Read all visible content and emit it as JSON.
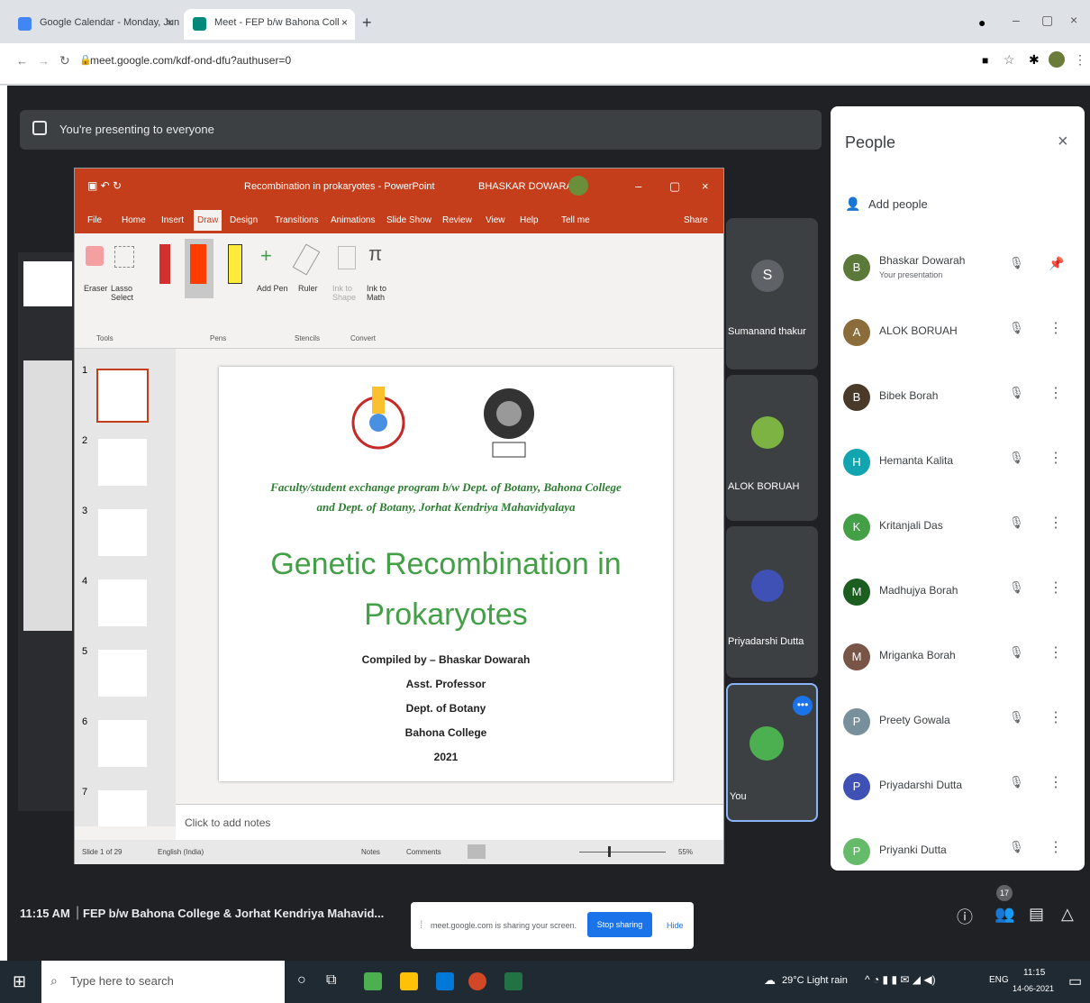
{
  "browser": {
    "tabs": [
      {
        "title": "Google Calendar - Monday, Jun",
        "close": "×"
      },
      {
        "title": "Meet - FEP b/w Bahona Coll",
        "close": "×"
      }
    ],
    "new_tab": "+",
    "url": "meet.google.com/kdf-ond-dfu?authuser=0"
  },
  "banner": {
    "text": "You're presenting to everyone"
  },
  "ppt": {
    "title": "Recombination in prokaryotes - PowerPoint",
    "user": "BHASKAR DOWARAH",
    "tabs": [
      "File",
      "Home",
      "Insert",
      "Draw",
      "Design",
      "Transitions",
      "Animations",
      "Slide Show",
      "Review",
      "View",
      "Help",
      "Tell me"
    ],
    "share": "Share",
    "ribbon": {
      "eraser": "Eraser",
      "lasso": "Lasso Select",
      "add_pen": "Add Pen",
      "ruler": "Ruler",
      "ink_shape": "Ink to Shape",
      "ink_math": "Ink to Math",
      "groups": [
        "Tools",
        "Pens",
        "Stencils",
        "Convert"
      ]
    },
    "slide_numbers": [
      "1",
      "2",
      "3",
      "4",
      "5",
      "6",
      "7"
    ],
    "slide": {
      "subtitle_line1": "Faculty/student exchange program b/w Dept. of Botany, Bahona College",
      "subtitle_line2": "and Dept. of Botany, Jorhat Kendriya Mahavidyalaya",
      "title_line1": "Genetic Recombination in",
      "title_line2": "Prokaryotes",
      "credits": [
        "Compiled by – Bhaskar Dowarah",
        "Asst. Professor",
        "Dept. of Botany",
        "Bahona College",
        "2021"
      ]
    },
    "notes": "Click to add notes",
    "status": {
      "slide": "Slide 1 of 29",
      "lang": "English (India)",
      "notes": "Notes",
      "comments": "Comments",
      "zoom": "55%"
    }
  },
  "tiles": [
    {
      "name": "Sumanand thakur",
      "initial": "S"
    },
    {
      "name": "ALOK BORUAH"
    },
    {
      "name": "Priyadarshi Dutta"
    },
    {
      "name": "You"
    }
  ],
  "people": {
    "title": "People",
    "close": "×",
    "add": "Add people",
    "list": [
      {
        "name": "Bhaskar Dowarah",
        "sub": "Your presentation",
        "initial": "B",
        "color": "#5b7a3a"
      },
      {
        "name": "ALOK BORUAH",
        "initial": "A",
        "color": "#8a6d3b"
      },
      {
        "name": "Bibek Borah",
        "initial": "B",
        "color": "#4a3a2a"
      },
      {
        "name": "Hemanta Kalita",
        "initial": "H",
        "color": "#12a4af"
      },
      {
        "name": "Kritanjali Das",
        "initial": "K",
        "color": "#43a047"
      },
      {
        "name": "Madhujya Borah",
        "initial": "M",
        "color": "#1b5e20"
      },
      {
        "name": "Mriganka Borah",
        "initial": "M",
        "color": "#795548"
      },
      {
        "name": "Preety Gowala",
        "initial": "P",
        "color": "#78909c"
      },
      {
        "name": "Priyadarshi Dutta",
        "initial": "P",
        "color": "#3f51b5"
      },
      {
        "name": "Priyanki Dutta",
        "initial": "P",
        "color": "#66bb6a"
      }
    ]
  },
  "meeting": {
    "time": "11:15 AM",
    "name": "FEP b/w Bahona College & Jorhat Kendriya Mahavid...",
    "count": "17"
  },
  "share_bar": {
    "text": "meet.google.com is sharing your screen.",
    "stop": "Stop sharing",
    "hide": "Hide"
  },
  "taskbar": {
    "search": "Type here to search",
    "weather": "29°C Light rain",
    "lang": "ENG",
    "time": "11:15",
    "date": "14-06-2021"
  }
}
